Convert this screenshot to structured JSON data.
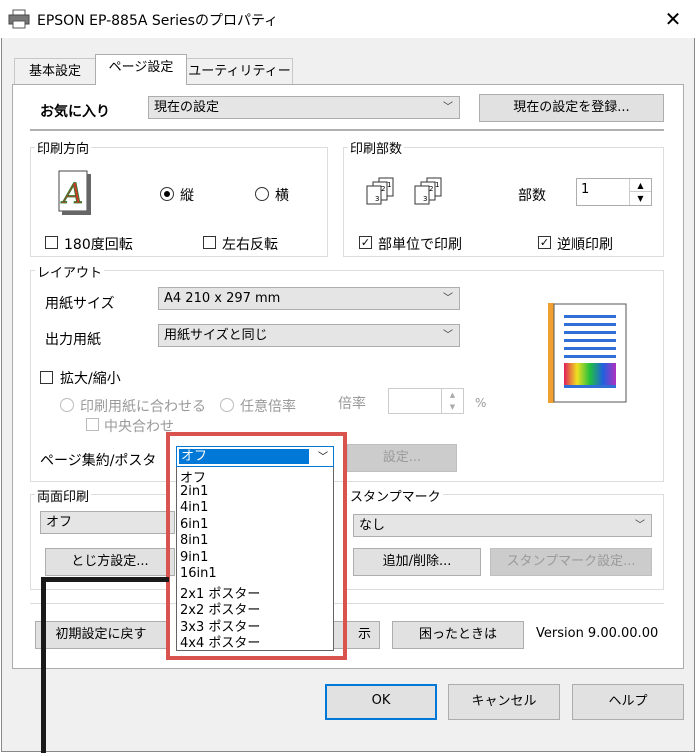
{
  "window": {
    "title": "EPSON EP-885A Seriesのプロパティ",
    "close_glyph": "✕"
  },
  "tabs": [
    {
      "label": "基本設定"
    },
    {
      "label": "ページ設定"
    },
    {
      "label": "ユーティリティー"
    }
  ],
  "favorites": {
    "label": "お気に入り",
    "selected": "現在の設定",
    "register_button": "現在の設定を登録..."
  },
  "orientation": {
    "title": "印刷方向",
    "portrait": "縦",
    "landscape": "横",
    "rotate180": "180度回転",
    "mirror": "左右反転"
  },
  "copies": {
    "title": "印刷部数",
    "count_label": "部数",
    "count_value": "1",
    "collate": "部単位で印刷",
    "reverse": "逆順印刷"
  },
  "layout": {
    "title": "レイアウト",
    "paper_size_label": "用紙サイズ",
    "paper_size_value": "A4 210 x 297 mm",
    "output_paper_label": "出力用紙",
    "output_paper_value": "用紙サイズと同じ",
    "scale_label": "拡大/縮小",
    "fit_to_paper": "印刷用紙に合わせる",
    "custom_scale": "任意倍率",
    "ratio_label": "倍率",
    "percent": "%",
    "center": "中央合わせ",
    "multipage_label": "ページ集約/ポスタ",
    "multipage_value": "オフ",
    "settings_button": "設定..."
  },
  "multipage_options": [
    "オフ",
    "2in1",
    "4in1",
    "6in1",
    "8in1",
    "9in1",
    "16in1",
    "2x1 ポスター",
    "2x2 ポスター",
    "3x3 ポスター",
    "4x4 ポスター"
  ],
  "duplex": {
    "title": "両面印刷",
    "value": "オフ",
    "binding_button": "とじ方設定..."
  },
  "stamp": {
    "title": "スタンプマーク",
    "value": "なし",
    "add_remove_button": "追加/削除...",
    "settings_button": "スタンプマーク設定..."
  },
  "footer": {
    "reset_button": "初期設定に戻す",
    "partial_button": "示",
    "help_trouble_button": "困ったときは",
    "version": "Version 9.00.00.00"
  },
  "dialog_buttons": {
    "ok": "OK",
    "cancel": "キャンセル",
    "help": "ヘルプ"
  },
  "colors": {
    "accent": "#0078d7",
    "highlight_box": "#d9534f"
  }
}
